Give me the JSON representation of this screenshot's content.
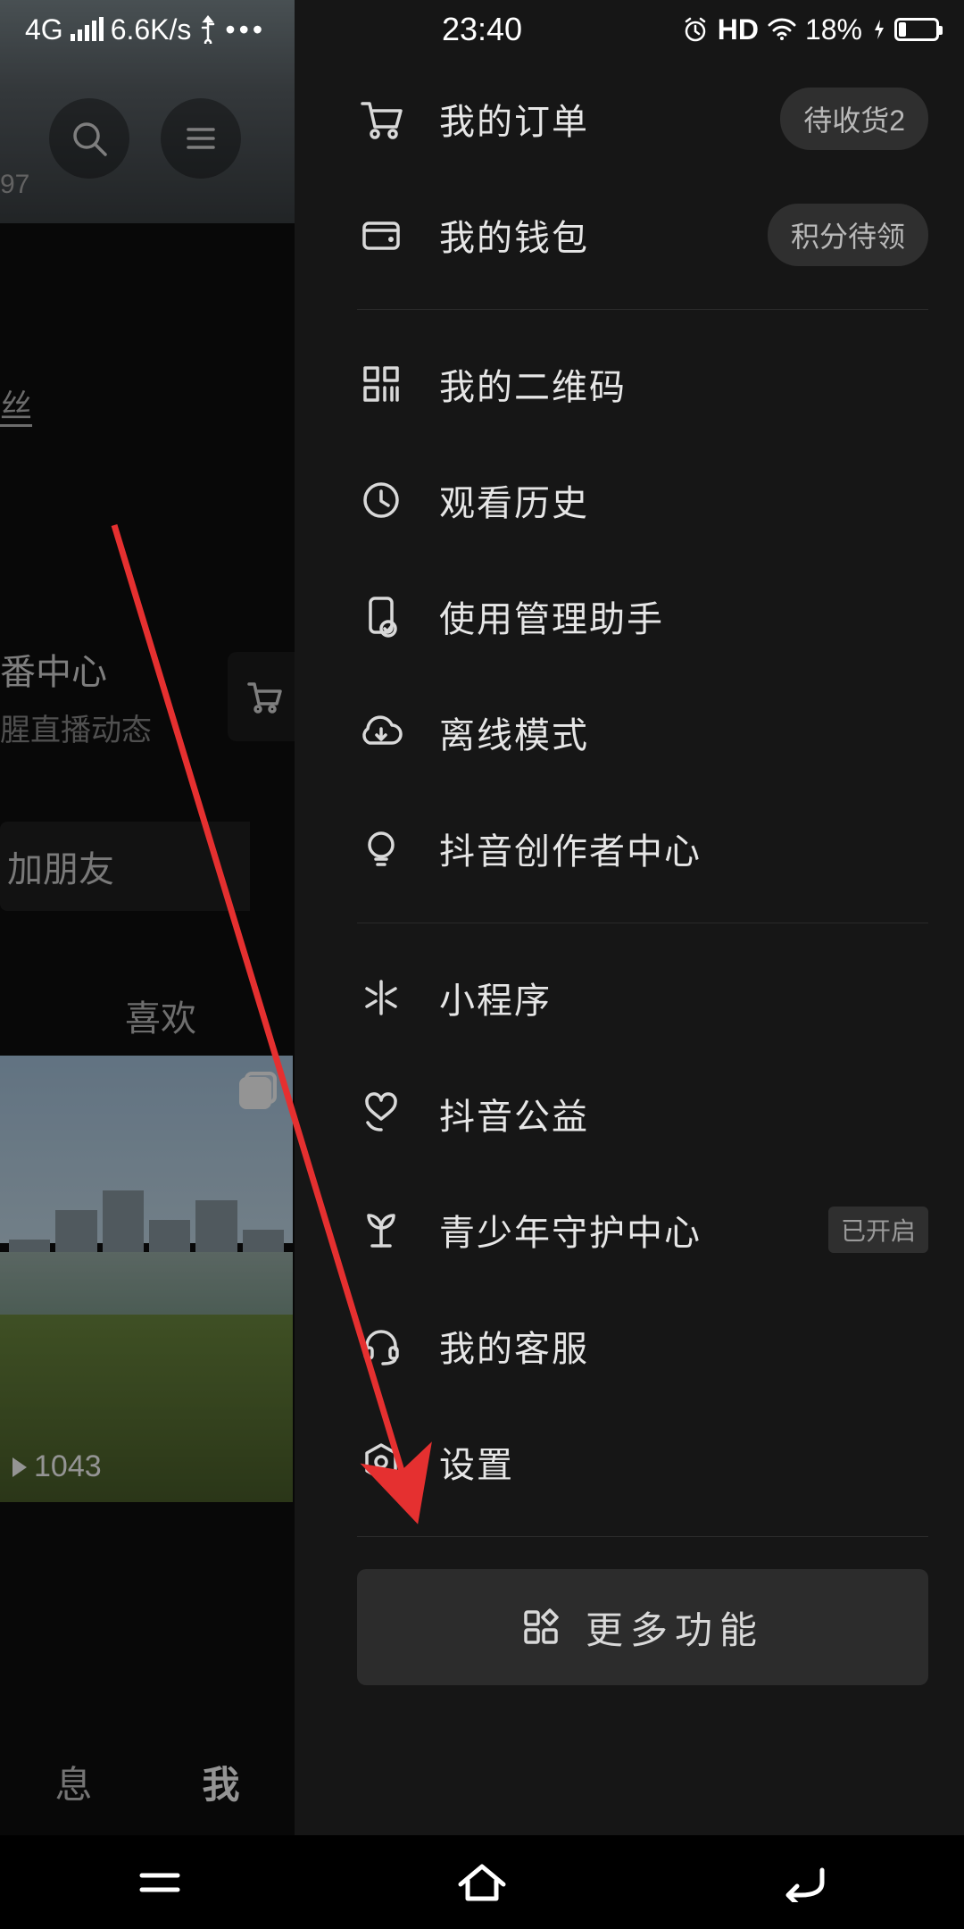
{
  "status": {
    "network": "4G",
    "speed": "6.6K/s",
    "time": "23:40",
    "hd": "HD",
    "battery_pct": "18%"
  },
  "background": {
    "small_text": "97",
    "fans_label": "丝",
    "center_title": "番中心",
    "center_sub": "腥直播动态",
    "add_friend": "加朋友",
    "tab_like": "喜欢",
    "play_count": "1043",
    "bottom_msg": "息",
    "bottom_me": "我"
  },
  "menu": {
    "orders": {
      "label": "我的订单",
      "badge": "待收货2"
    },
    "wallet": {
      "label": "我的钱包",
      "badge": "积分待领"
    },
    "qrcode": {
      "label": "我的二维码"
    },
    "history": {
      "label": "观看历史"
    },
    "assistant": {
      "label": "使用管理助手"
    },
    "offline": {
      "label": "离线模式"
    },
    "creator": {
      "label": "抖音创作者中心"
    },
    "miniapp": {
      "label": "小程序"
    },
    "charity": {
      "label": "抖音公益"
    },
    "youth": {
      "label": "青少年守护中心",
      "tag": "已开启"
    },
    "support": {
      "label": "我的客服"
    },
    "settings": {
      "label": "设置"
    },
    "more": {
      "label": "更多功能"
    }
  }
}
